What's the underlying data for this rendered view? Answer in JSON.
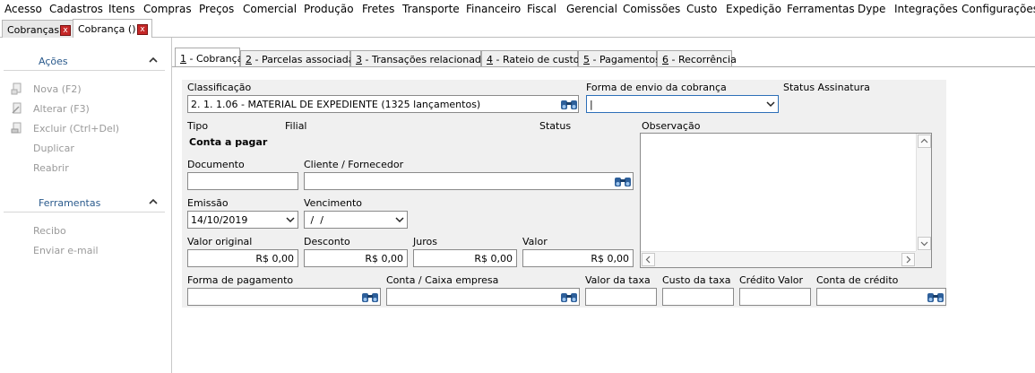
{
  "menubar": [
    "Acesso",
    "Cadastros",
    "Itens",
    "Compras",
    "Preços",
    "Comercial",
    "Produção",
    "Fretes",
    "Transporte",
    "Financeiro",
    "Fiscal",
    "Gerencial",
    "Comissões",
    "Custo",
    "Expedição",
    "Ferramentas",
    "Dype",
    "Integrações",
    "Configurações"
  ],
  "doc_tabs": [
    {
      "label": "Cobranças",
      "close": "x"
    },
    {
      "label": "Cobrança ()",
      "close": "x"
    }
  ],
  "left_panel": {
    "acoes": {
      "title": "Ações",
      "items": [
        "Nova (F2)",
        "Alterar (F3)",
        "Excluir (Ctrl+Del)",
        "Duplicar",
        "Reabrir"
      ]
    },
    "ferramentas": {
      "title": "Ferramentas",
      "items": [
        "Recibo",
        "Enviar e-mail"
      ]
    }
  },
  "form_tabs": [
    {
      "key": "1",
      "label": " - Cobrança"
    },
    {
      "key": "2",
      "label": " - Parcelas associadas"
    },
    {
      "key": "3",
      "label": " - Transações relacionadas"
    },
    {
      "key": "4",
      "label": " - Rateio de custos"
    },
    {
      "key": "5",
      "label": " - Pagamentos"
    },
    {
      "key": "6",
      "label": " - Recorrência"
    }
  ],
  "form": {
    "classificacao": {
      "label": "Classificação",
      "value": "2. 1. 1.06 - MATERIAL DE EXPEDIENTE (1325 lançamentos)"
    },
    "forma_envio": {
      "label": "Forma de envio da cobrança",
      "value": "|"
    },
    "status_assinatura": {
      "label": "Status Assinatura"
    },
    "tipo": {
      "label": "Tipo",
      "value": "Conta a pagar"
    },
    "filial": {
      "label": "Filial"
    },
    "status": {
      "label": "Status"
    },
    "observacao": {
      "label": "Observação"
    },
    "documento": {
      "label": "Documento",
      "value": ""
    },
    "cliente": {
      "label": "Cliente / Fornecedor",
      "value": ""
    },
    "emissao": {
      "label": "Emissão",
      "value": "14/10/2019"
    },
    "vencimento": {
      "label": "Vencimento",
      "value": " /  /"
    },
    "valor_original": {
      "label": "Valor original",
      "value": "R$ 0,00"
    },
    "desconto": {
      "label": "Desconto",
      "value": "R$ 0,00"
    },
    "juros": {
      "label": "Juros",
      "value": "R$ 0,00"
    },
    "valor": {
      "label": "Valor",
      "value": "R$ 0,00"
    },
    "forma_pagamento": {
      "label": "Forma de pagamento",
      "value": ""
    },
    "conta_caixa": {
      "label": "Conta / Caixa empresa",
      "value": ""
    },
    "valor_taxa": {
      "label": "Valor da taxa",
      "value": ""
    },
    "custo_taxa": {
      "label": "Custo da taxa",
      "value": ""
    },
    "credito_valor": {
      "label": "Crédito Valor",
      "value": ""
    },
    "conta_credito": {
      "label": "Conta de crédito",
      "value": ""
    }
  },
  "colors": {
    "accent_text": "#2a5a8c",
    "close_red": "#c62828",
    "form_bg": "#f0f0f0",
    "disabled_text": "#9a9a9a"
  }
}
